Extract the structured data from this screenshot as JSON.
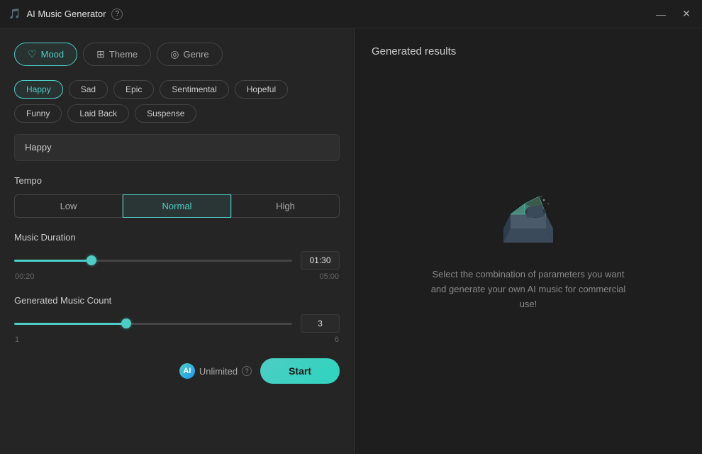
{
  "titlebar": {
    "title": "AI Music Generator",
    "help_label": "?",
    "minimize_label": "—",
    "close_label": "✕"
  },
  "tabs": [
    {
      "id": "mood",
      "label": "Mood",
      "icon": "♡",
      "active": true
    },
    {
      "id": "theme",
      "label": "Theme",
      "icon": "🎨",
      "active": false
    },
    {
      "id": "genre",
      "label": "Genre",
      "icon": "🎵",
      "active": false
    }
  ],
  "mood": {
    "pills": [
      {
        "label": "Happy",
        "selected": true
      },
      {
        "label": "Sad",
        "selected": false
      },
      {
        "label": "Epic",
        "selected": false
      },
      {
        "label": "Sentimental",
        "selected": false
      },
      {
        "label": "Hopeful",
        "selected": false
      },
      {
        "label": "Funny",
        "selected": false
      },
      {
        "label": "Laid Back",
        "selected": false
      },
      {
        "label": "Suspense",
        "selected": false
      }
    ],
    "selected_value": "Happy"
  },
  "tempo": {
    "label": "Tempo",
    "options": [
      {
        "label": "Low",
        "active": false
      },
      {
        "label": "Normal",
        "active": true
      },
      {
        "label": "High",
        "active": false
      }
    ]
  },
  "music_duration": {
    "label": "Music Duration",
    "min": "00:20",
    "max": "05:00",
    "value": "01:30",
    "percent": 27
  },
  "generated_count": {
    "label": "Generated Music Count",
    "min": "1",
    "max": "6",
    "value": "3",
    "percent": 40
  },
  "unlimited": {
    "label": "Unlimited",
    "icon_text": "AI"
  },
  "start_button": {
    "label": "Start"
  },
  "results": {
    "title": "Generated results",
    "empty_text": "Select the combination of parameters you want and generate your own AI music for commercial use!"
  }
}
